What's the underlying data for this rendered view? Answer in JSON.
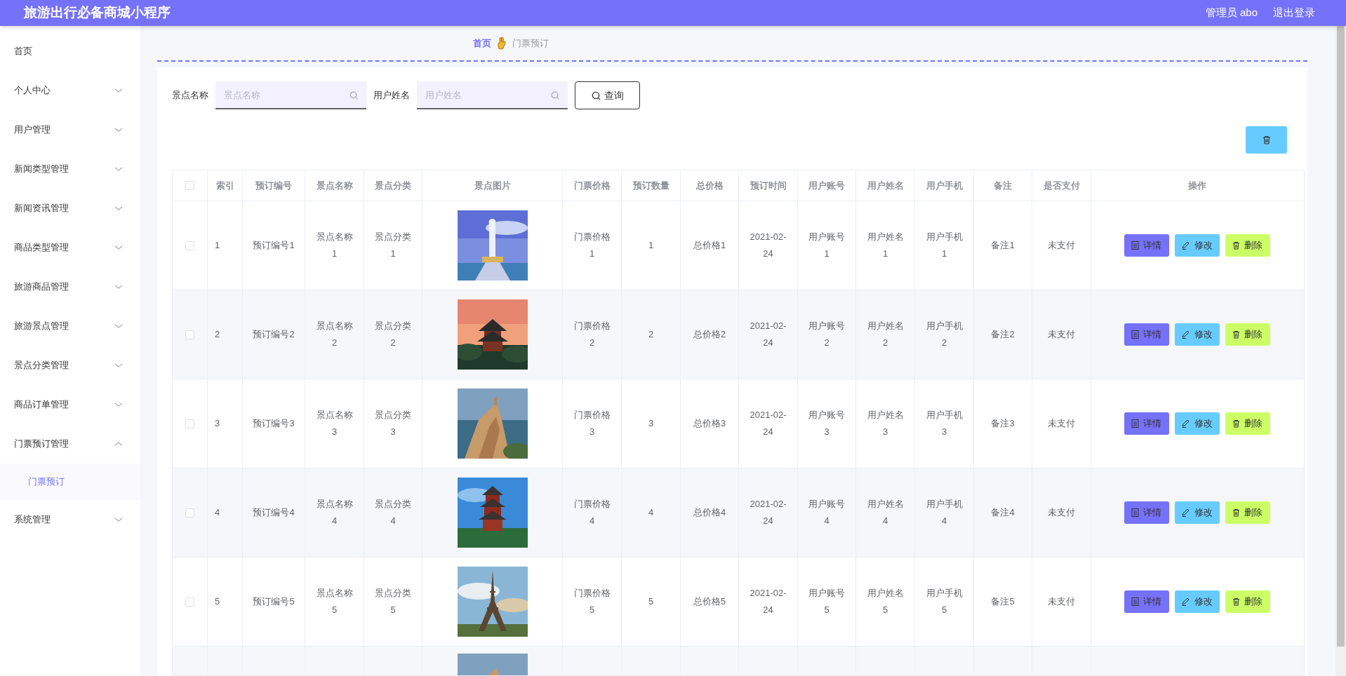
{
  "app_title": "旅游出行必备商城小程序",
  "user": {
    "label": "管理员 abo",
    "logout": "退出登录"
  },
  "sidebar": {
    "items": [
      {
        "label": "首页"
      },
      {
        "label": "个人中心",
        "expanded": false
      },
      {
        "label": "用户管理",
        "expanded": false
      },
      {
        "label": "新闻类型管理",
        "expanded": false
      },
      {
        "label": "新闻资讯管理",
        "expanded": false
      },
      {
        "label": "商品类型管理",
        "expanded": false
      },
      {
        "label": "旅游商品管理",
        "expanded": false
      },
      {
        "label": "旅游景点管理",
        "expanded": false
      },
      {
        "label": "景点分类管理",
        "expanded": false
      },
      {
        "label": "商品订单管理",
        "expanded": false
      },
      {
        "label": "门票预订管理",
        "expanded": true,
        "children": [
          {
            "label": "门票预订",
            "selected": true
          }
        ]
      },
      {
        "label": "系统管理",
        "expanded": false
      }
    ]
  },
  "breadcrumb": [
    "首页",
    "门票预订"
  ],
  "search": {
    "fields": [
      {
        "label": "景点名称",
        "placeholder": "景点名称"
      },
      {
        "label": "用户姓名",
        "placeholder": "用户姓名"
      }
    ],
    "button": "查询"
  },
  "table": {
    "header_checked": false,
    "columns": [
      "索引",
      "预订编号",
      "景点名称",
      "景点分类",
      "景点图片",
      "门票价格",
      "预订数量",
      "总价格",
      "预订时间",
      "用户账号",
      "用户姓名",
      "用户手机",
      "备注",
      "是否支付",
      "操作"
    ],
    "rows": [
      {
        "cut_off": false,
        "checked": false,
        "cells": [
          "1",
          "预订编号1",
          "景点名称1",
          "景点分类1",
          null,
          "门票价格1",
          "1",
          "总价格1",
          "2021-02-24",
          "用户账号1",
          "用户姓名1",
          "用户手机1",
          "备注1",
          "未支付"
        ],
        "actions": [
          "详情",
          "修改",
          "删除"
        ]
      },
      {
        "cut_off": false,
        "checked": false,
        "cells": [
          "2",
          "预订编号2",
          "景点名称2",
          "景点分类2",
          null,
          "门票价格2",
          "2",
          "总价格2",
          "2021-02-24",
          "用户账号2",
          "用户姓名2",
          "用户手机2",
          "备注2",
          "未支付"
        ],
        "actions": [
          "详情",
          "修改",
          "删除"
        ]
      },
      {
        "cut_off": false,
        "checked": false,
        "cells": [
          "3",
          "预订编号3",
          "景点名称3",
          "景点分类3",
          null,
          "门票价格3",
          "3",
          "总价格3",
          "2021-02-24",
          "用户账号3",
          "用户姓名3",
          "用户手机3",
          "备注3",
          "未支付"
        ],
        "actions": [
          "详情",
          "修改",
          "删除"
        ]
      },
      {
        "cut_off": false,
        "checked": false,
        "cells": [
          "4",
          "预订编号4",
          "景点名称4",
          "景点分类4",
          null,
          "门票价格4",
          "4",
          "总价格4",
          "2021-02-24",
          "用户账号4",
          "用户姓名4",
          "用户手机4",
          "备注4",
          "未支付"
        ],
        "actions": [
          "详情",
          "修改",
          "删除"
        ]
      },
      {
        "cut_off": false,
        "checked": false,
        "cells": [
          "5",
          "预订编号5",
          "景点名称5",
          "景点分类5",
          null,
          "门票价格5",
          "5",
          "总价格5",
          "2021-02-24",
          "用户账号5",
          "用户姓名5",
          "用户手机5",
          "备注5",
          "未支付"
        ],
        "actions": [
          "详情",
          "修改",
          "删除"
        ]
      },
      {
        "cut_off": true
      }
    ]
  }
}
